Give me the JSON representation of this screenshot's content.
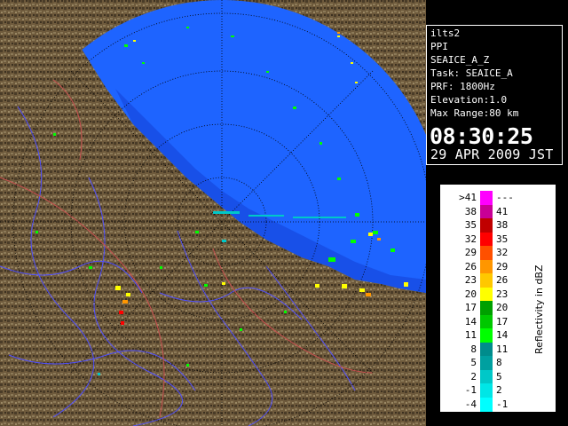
{
  "radar_display": {
    "name": "ilts2",
    "scan_type": "PPI",
    "product": "SEAICE_A_Z",
    "task": "Task: SEAICE_A",
    "prf": "PRF: 1800Hz",
    "elevation": "Elevation:1.0",
    "max_range": "Max Range:80 km",
    "time": "08:30:25",
    "date": "29 APR 2009 JST"
  },
  "legend": {
    "title": "Reflectivity in dBZ",
    "rows": [
      {
        "low": ">41",
        "high": "---",
        "color": "#ff00ff"
      },
      {
        "low": "38",
        "high": "41",
        "color": "#c80096"
      },
      {
        "low": "35",
        "high": "38",
        "color": "#c00000"
      },
      {
        "low": "32",
        "high": "35",
        "color": "#ff0000"
      },
      {
        "low": "29",
        "high": "32",
        "color": "#ff5000"
      },
      {
        "low": "26",
        "high": "29",
        "color": "#ff9600"
      },
      {
        "low": "23",
        "high": "26",
        "color": "#ffc800"
      },
      {
        "low": "20",
        "high": "23",
        "color": "#ffff00"
      },
      {
        "low": "17",
        "high": "20",
        "color": "#00a000"
      },
      {
        "low": "14",
        "high": "17",
        "color": "#00c800"
      },
      {
        "low": "11",
        "high": "14",
        "color": "#00ff00"
      },
      {
        "low": "8",
        "high": "11",
        "color": "#008c8c"
      },
      {
        "low": "5",
        "high": "8",
        "color": "#00a0a0"
      },
      {
        "low": "2",
        "high": "5",
        "color": "#00c8c8"
      },
      {
        "low": "-1",
        "high": "2",
        "color": "#00e6e6"
      },
      {
        "low": "-4",
        "high": "-1",
        "color": "#00ffff"
      }
    ]
  },
  "colors": {
    "sea_background": "#1e64ff",
    "sea_inner": "#1050e0",
    "land": "#6e5a3c",
    "land_dark": "#4a3c28",
    "rivers": "#5050ff",
    "boundaries": "#c85050",
    "range_rings": "#000000"
  }
}
